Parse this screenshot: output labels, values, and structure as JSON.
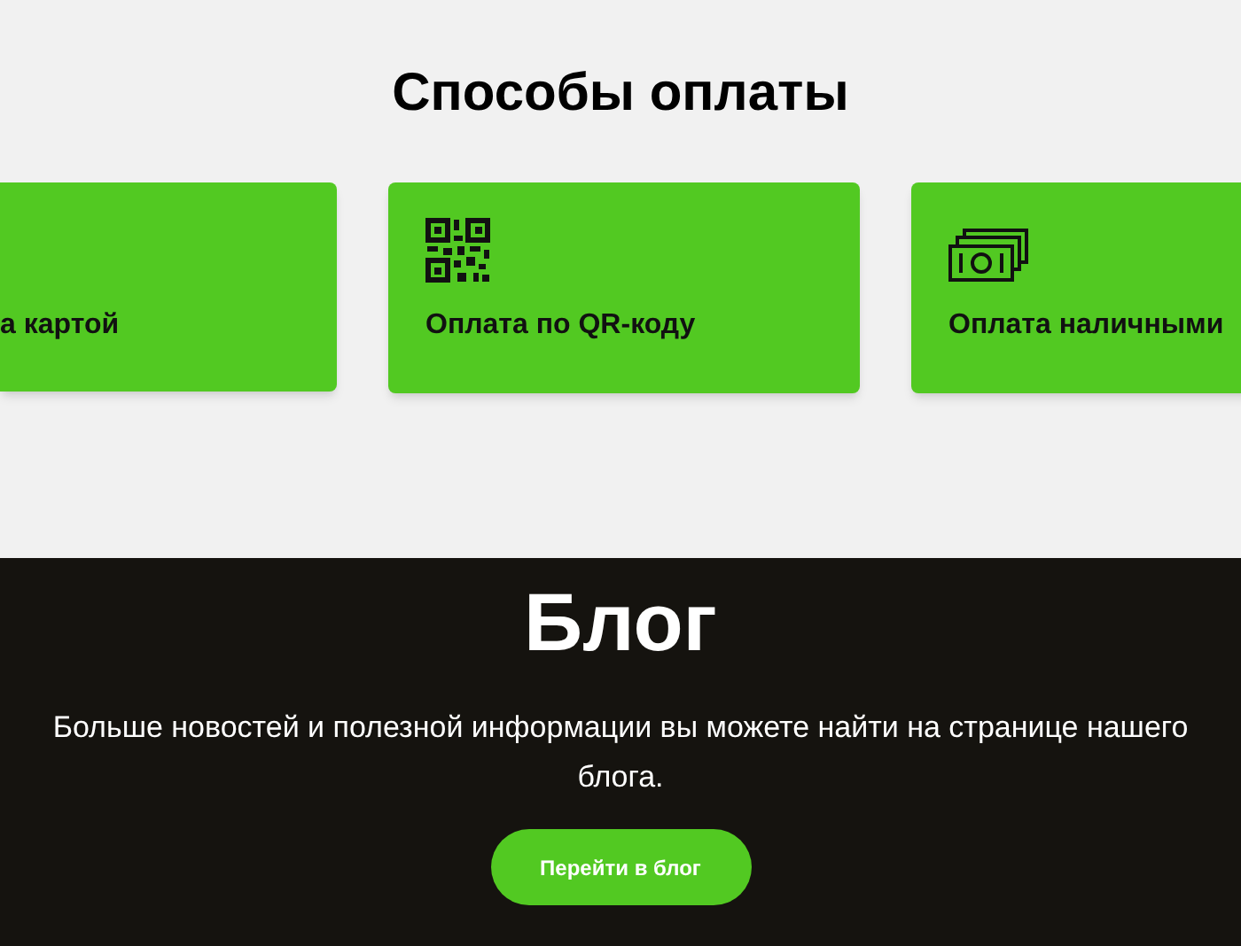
{
  "payments": {
    "title": "Способы оплаты",
    "cards": [
      {
        "label": "а картой",
        "kind": "none"
      },
      {
        "label": "Оплата по QR-коду",
        "kind": "qr"
      },
      {
        "label": "Оплата наличными",
        "kind": "cash"
      }
    ]
  },
  "blog": {
    "title": "Блог",
    "text": "Больше новостей и полезной информации вы можете найти на странице нашего блога.",
    "button": "Перейти в блог"
  }
}
